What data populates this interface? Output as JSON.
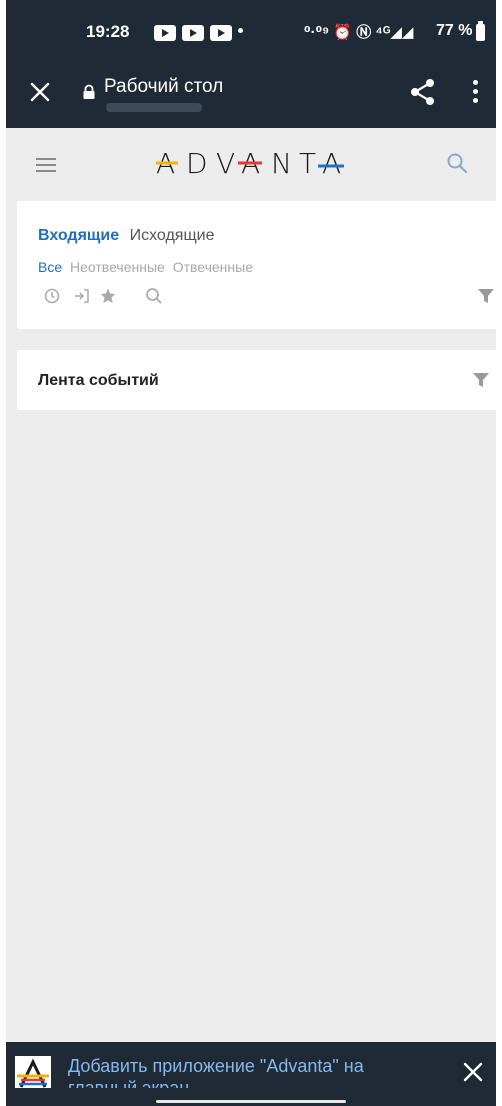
{
  "status_bar": {
    "time": "19:28",
    "extra_icons": "⁰·⁰⁹ ⏰ Ⓝ ⁴ᴳ◢◢",
    "battery": "77 %"
  },
  "toolbar": {
    "close_icon": "close-icon",
    "title": "Рабочий стол",
    "share_icon": "share-icon",
    "more_icon": "more-vert-icon"
  },
  "header": {
    "logo_text": "ADVANTA",
    "accent_colors": [
      "#f2b400",
      "#e53935",
      "#1f6fc0"
    ]
  },
  "calls_card": {
    "tabs": [
      "Входящие",
      "Исходящие"
    ],
    "active_tab": "Входящие",
    "subtabs": [
      "Все",
      "Неотвеченные",
      "Отвеченные"
    ],
    "active_subtab": "Все",
    "icons": [
      "clock-icon",
      "login-icon",
      "star-icon",
      "search-icon",
      "filter-icon"
    ]
  },
  "feed_card": {
    "title": "Лента событий"
  },
  "install_banner": {
    "text": "Добавить приложение \"Advanta\" на главный экран",
    "close_icon": "close-icon"
  },
  "colors": {
    "toolbar_bg": "#1f2a36",
    "accent": "#1f6fc0",
    "page_bg": "#ececec",
    "banner_link": "#86b9ee"
  }
}
